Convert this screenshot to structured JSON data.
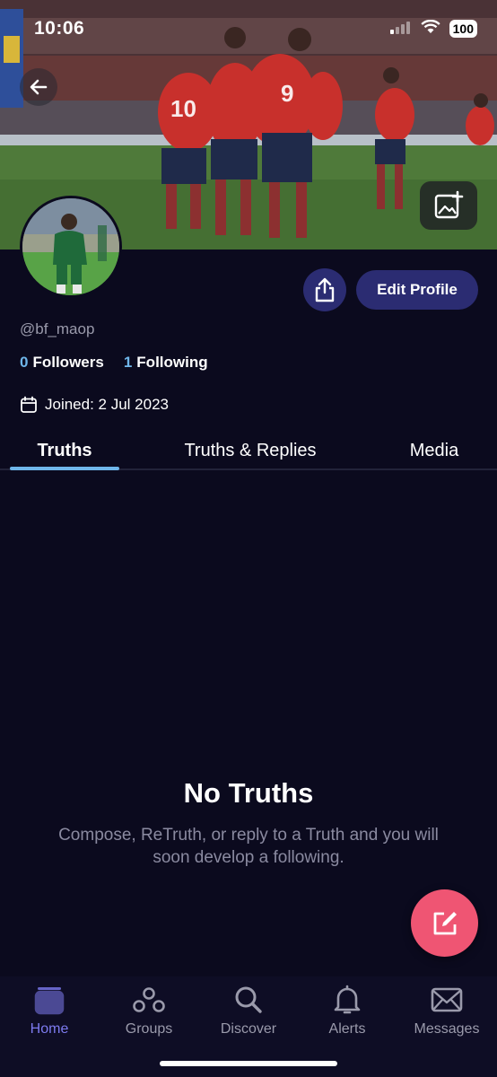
{
  "status_bar": {
    "time": "10:06",
    "battery": "100"
  },
  "profile": {
    "handle": "@bf_maop",
    "followers_count": "0",
    "followers_label": "Followers",
    "following_count": "1",
    "following_label": "Following",
    "joined": "Joined: 2 Jul 2023",
    "edit_profile_label": "Edit Profile"
  },
  "tabs": [
    {
      "label": "Truths",
      "active": true
    },
    {
      "label": "Truths & Replies",
      "active": false
    },
    {
      "label": "Media",
      "active": false
    }
  ],
  "empty_state": {
    "title": "No Truths",
    "text": "Compose, ReTruth, or reply to a Truth and you will soon develop a following."
  },
  "nav": [
    {
      "label": "Home",
      "icon": "home-icon",
      "active": true
    },
    {
      "label": "Groups",
      "icon": "groups-icon",
      "active": false
    },
    {
      "label": "Discover",
      "icon": "search-icon",
      "active": false
    },
    {
      "label": "Alerts",
      "icon": "bell-icon",
      "active": false
    },
    {
      "label": "Messages",
      "icon": "mail-icon",
      "active": false
    }
  ],
  "colors": {
    "background": "#0b0a1e",
    "accent_blue": "#6fb6ea",
    "button_navy": "#2b2c72",
    "fab_pink": "#ef5573",
    "nav_active": "#7d7bf0"
  }
}
